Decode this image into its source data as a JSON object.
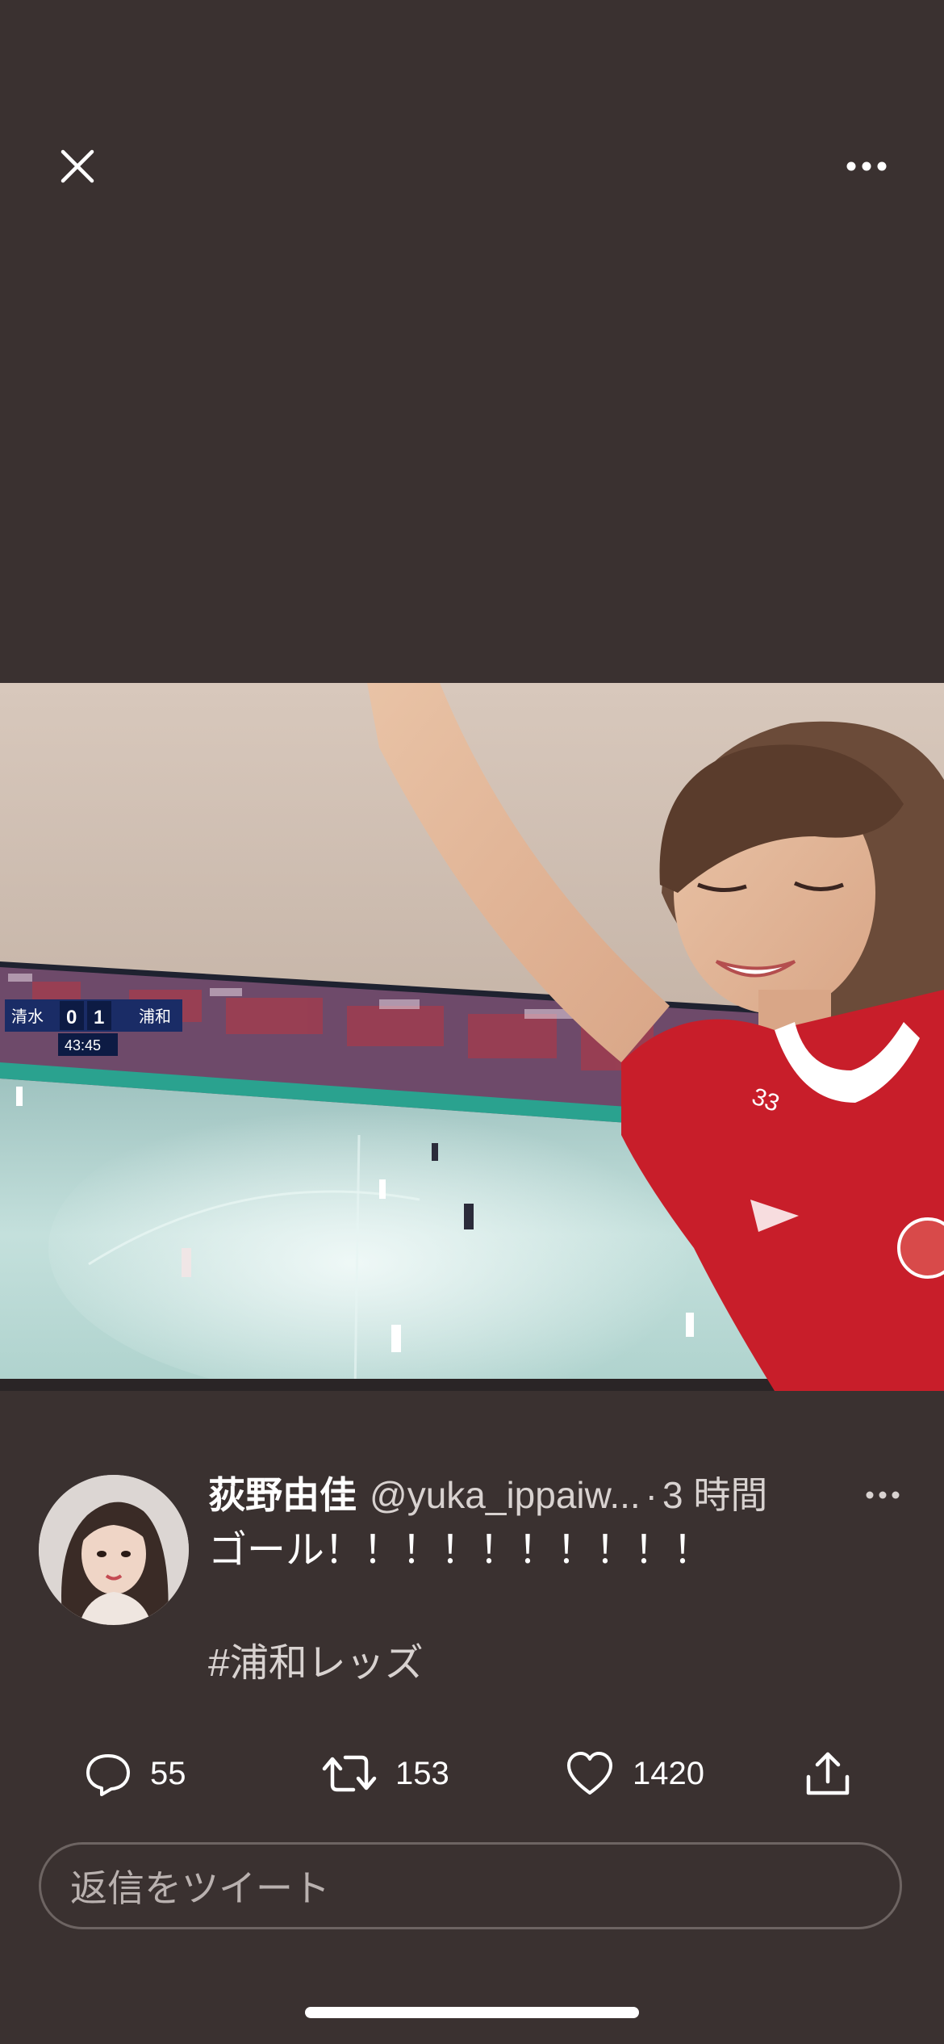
{
  "top_bar": {
    "close_icon": "close-icon",
    "more_icon": "more-horizontal-icon"
  },
  "media": {
    "scoreboard_home": "清水",
    "scoreboard_home_score": "0",
    "scoreboard_away_score": "1",
    "scoreboard_away": "浦和",
    "scoreboard_clock": "43:45",
    "jersey_number": "33"
  },
  "tweet": {
    "display_name": "荻野由佳",
    "handle": "@yuka_ippaiw...",
    "separator": "·",
    "time": "3 時間",
    "text": "ゴール！！！！！！！！！！",
    "hashtag": "#浦和レッズ"
  },
  "actions": {
    "replies": "55",
    "retweets": "153",
    "likes": "1420"
  },
  "reply_box": {
    "placeholder": "返信をツイート"
  },
  "colors": {
    "background": "#3a3130",
    "text": "#ffffff",
    "secondary_text": "#d8d2d0"
  }
}
